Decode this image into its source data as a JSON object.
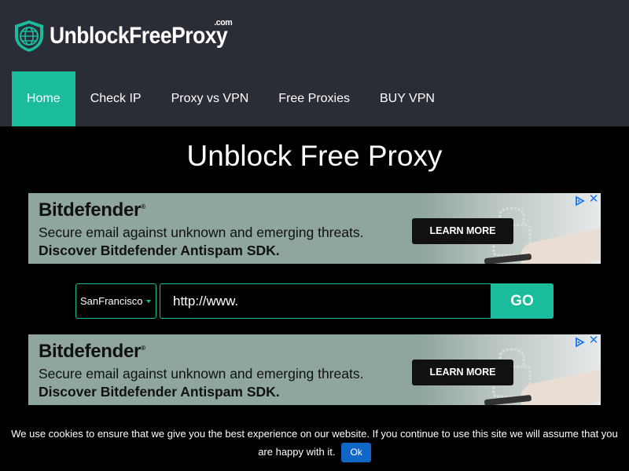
{
  "site": {
    "logo_text": "UnblockFreeProxy",
    "logo_suffix": ".com"
  },
  "nav": {
    "items": [
      {
        "label": "Home",
        "active": true
      },
      {
        "label": "Check IP",
        "active": false
      },
      {
        "label": "Proxy vs VPN",
        "active": false
      },
      {
        "label": "Free Proxies",
        "active": false
      },
      {
        "label": "BUY VPN",
        "active": false
      }
    ]
  },
  "page": {
    "title": "Unblock Free Proxy"
  },
  "ads": [
    {
      "brand": "Bitdefender",
      "brand_mark": "®",
      "line1": "Secure email against unknown and emerging threats.",
      "line2": "Discover Bitdefender Antispam SDK.",
      "cta": "LEARN MORE"
    },
    {
      "brand": "Bitdefender",
      "brand_mark": "®",
      "line1": "Secure email against unknown and emerging threats.",
      "line2": "Discover Bitdefender Antispam SDK.",
      "cta": "LEARN MORE"
    }
  ],
  "proxy_form": {
    "server_selected": "SanFrancisco",
    "url_value": "http://www.",
    "go_label": "GO"
  },
  "cookie_notice": {
    "text": "We use cookies to ensure that we give you the best experience on our website. If you continue to use this site we will assume that you are happy with it.",
    "ok_label": "Ok"
  },
  "colors": {
    "accent": "#1abc9c",
    "header_bg": "#2a2d35",
    "page_bg": "#000000",
    "ok_button": "#1167c8"
  },
  "icons": {
    "logo": "globe-shield-icon",
    "ad_choices": "adchoices-icon",
    "ad_close": "close-icon",
    "select_arrow": "chevron-down-icon"
  }
}
